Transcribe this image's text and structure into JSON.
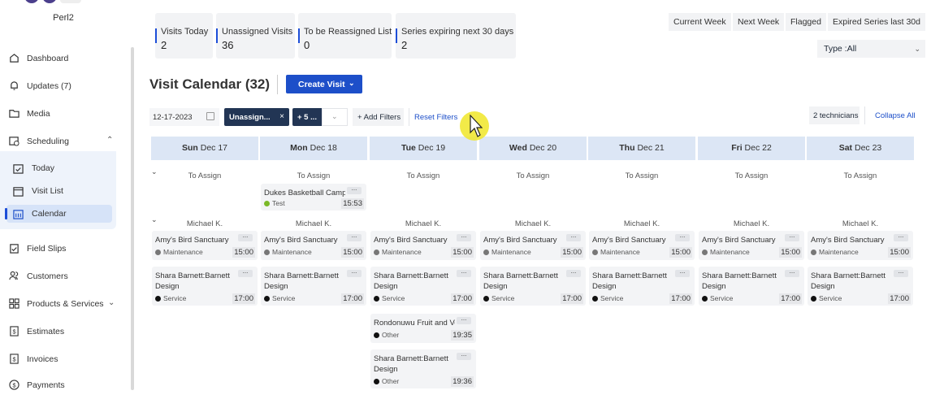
{
  "sidebar": {
    "brand": "Perl2",
    "items": [
      {
        "label": "Dashboard",
        "icon": "house-icon"
      },
      {
        "label": "Updates (7)",
        "icon": "bell-icon"
      },
      {
        "label": "Media",
        "icon": "folder-icon"
      },
      {
        "label": "Scheduling",
        "icon": "calendar-clock-icon"
      },
      {
        "label": "Field Slips",
        "icon": "clipboard-check-icon"
      },
      {
        "label": "Customers",
        "icon": "users-icon"
      },
      {
        "label": "Products & Services",
        "icon": "grid-icon"
      },
      {
        "label": "Estimates",
        "icon": "dollar-doc-icon"
      },
      {
        "label": "Invoices",
        "icon": "dollar-doc-icon"
      },
      {
        "label": "Payments",
        "icon": "dollar-icon"
      }
    ],
    "scheduling_sub": [
      {
        "label": "Today",
        "icon": "calendar-check-icon"
      },
      {
        "label": "Visit List",
        "icon": "calendar-icon"
      },
      {
        "label": "Calendar",
        "icon": "calendar-grid-icon"
      }
    ]
  },
  "stats": [
    {
      "title": "Visits Today",
      "value": "2"
    },
    {
      "title": "Unassigned Visits",
      "value": "36"
    },
    {
      "title": "To be Reassigned List",
      "value": "0"
    },
    {
      "title": "Series expiring next 30 days",
      "value": "2"
    }
  ],
  "top_buttons": [
    "Current Week",
    "Next Week",
    "Flagged",
    "Expired Series last 30d"
  ],
  "type_select": "Type :All",
  "header": {
    "title": "Visit Calendar",
    "count": "(32)",
    "create_label": "Create Visit"
  },
  "filters": {
    "date": "12-17-2023",
    "chip1": "Unassign...",
    "chip2": "+ 5 ...",
    "add_label": "+ Add Filters",
    "reset_label": "Reset Filters",
    "tech_label": "2 technicians",
    "collapse_label": "Collapse All"
  },
  "days": [
    {
      "dow": "Sun",
      "date": "Dec 17"
    },
    {
      "dow": "Mon",
      "date": "Dec 18"
    },
    {
      "dow": "Tue",
      "date": "Dec 19"
    },
    {
      "dow": "Wed",
      "date": "Dec 20"
    },
    {
      "dow": "Thu",
      "date": "Dec 21"
    },
    {
      "dow": "Fri",
      "date": "Dec 22"
    },
    {
      "dow": "Sat",
      "date": "Dec 23"
    }
  ],
  "rows": {
    "to_assign": "To Assign",
    "tech": "Michael K."
  },
  "unassigned_card": {
    "name": "Dukes Basketball Camp",
    "tag": "Test",
    "time": "15:53",
    "color": "#7bb928"
  },
  "tech_cards": [
    {
      "name": "Amy's Bird Sanctuary",
      "tag": "Maintenance",
      "time": "15:00",
      "color": "#777777"
    },
    {
      "name": "Shara Barnett:Barnett Design",
      "tag": "Service",
      "time": "17:00",
      "color": "#111111"
    }
  ],
  "extra_cards": [
    {
      "name": "Rondonuwu Fruit and Vegi",
      "tag": "Other",
      "time": "19:35",
      "color": "#111111"
    },
    {
      "name": "Shara Barnett:Barnett Design",
      "tag": "Other",
      "time": "19:36",
      "color": "#111111"
    }
  ],
  "colors": {
    "accent": "#1d4fc9",
    "chip": "#223554",
    "day_header": "#dce6f5"
  }
}
